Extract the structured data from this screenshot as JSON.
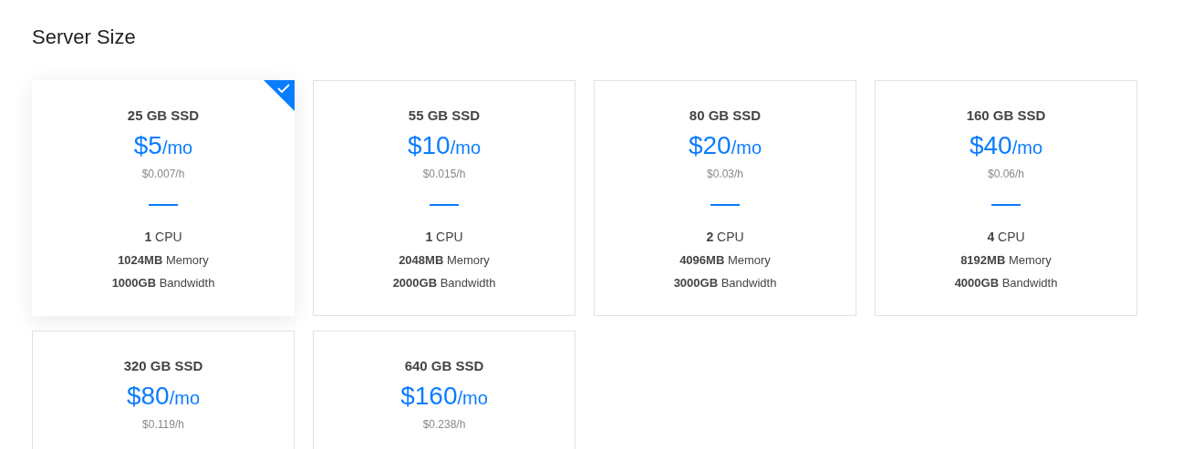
{
  "title": "Server Size",
  "plans": [
    {
      "storage": "25 GB SSD",
      "price": "$5",
      "unit": "/mo",
      "hourly": "$0.007/h",
      "selected": true,
      "specs": [
        {
          "value": "1",
          "label": "CPU"
        },
        {
          "value": "1024MB",
          "label": "Memory"
        },
        {
          "value": "1000GB",
          "label": "Bandwidth"
        }
      ]
    },
    {
      "storage": "55 GB SSD",
      "price": "$10",
      "unit": "/mo",
      "hourly": "$0.015/h",
      "selected": false,
      "specs": [
        {
          "value": "1",
          "label": "CPU"
        },
        {
          "value": "2048MB",
          "label": "Memory"
        },
        {
          "value": "2000GB",
          "label": "Bandwidth"
        }
      ]
    },
    {
      "storage": "80 GB SSD",
      "price": "$20",
      "unit": "/mo",
      "hourly": "$0.03/h",
      "selected": false,
      "specs": [
        {
          "value": "2",
          "label": "CPU"
        },
        {
          "value": "4096MB",
          "label": "Memory"
        },
        {
          "value": "3000GB",
          "label": "Bandwidth"
        }
      ]
    },
    {
      "storage": "160 GB SSD",
      "price": "$40",
      "unit": "/mo",
      "hourly": "$0.06/h",
      "selected": false,
      "specs": [
        {
          "value": "4",
          "label": "CPU"
        },
        {
          "value": "8192MB",
          "label": "Memory"
        },
        {
          "value": "4000GB",
          "label": "Bandwidth"
        }
      ]
    },
    {
      "storage": "320 GB SSD",
      "price": "$80",
      "unit": "/mo",
      "hourly": "$0.119/h",
      "selected": false
    },
    {
      "storage": "640 GB SSD",
      "price": "$160",
      "unit": "/mo",
      "hourly": "$0.238/h",
      "selected": false
    }
  ]
}
